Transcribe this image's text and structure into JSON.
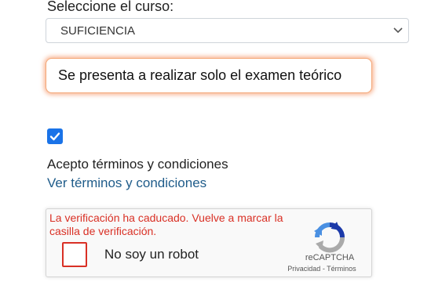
{
  "course": {
    "label": "Seleccione el curso:",
    "selected": "SUFICIENCIA"
  },
  "notice": {
    "text": "Se presenta a realizar solo el examen teórico"
  },
  "terms": {
    "checked": true,
    "label": "Acepto términos y condiciones",
    "link": "Ver términos y condiciones"
  },
  "recaptcha": {
    "error": "La verificación ha caducado. Vuelve a marcar la casilla de verificación.",
    "checkbox_label": "No soy un robot",
    "brand": "reCAPTCHA",
    "privacy": "Privacidad",
    "separator": " - ",
    "terms": "Términos"
  },
  "colors": {
    "accent": "#1a73e8",
    "error": "#d93025",
    "link": "#1f5c8a",
    "notice_glow": "#f2783c"
  }
}
